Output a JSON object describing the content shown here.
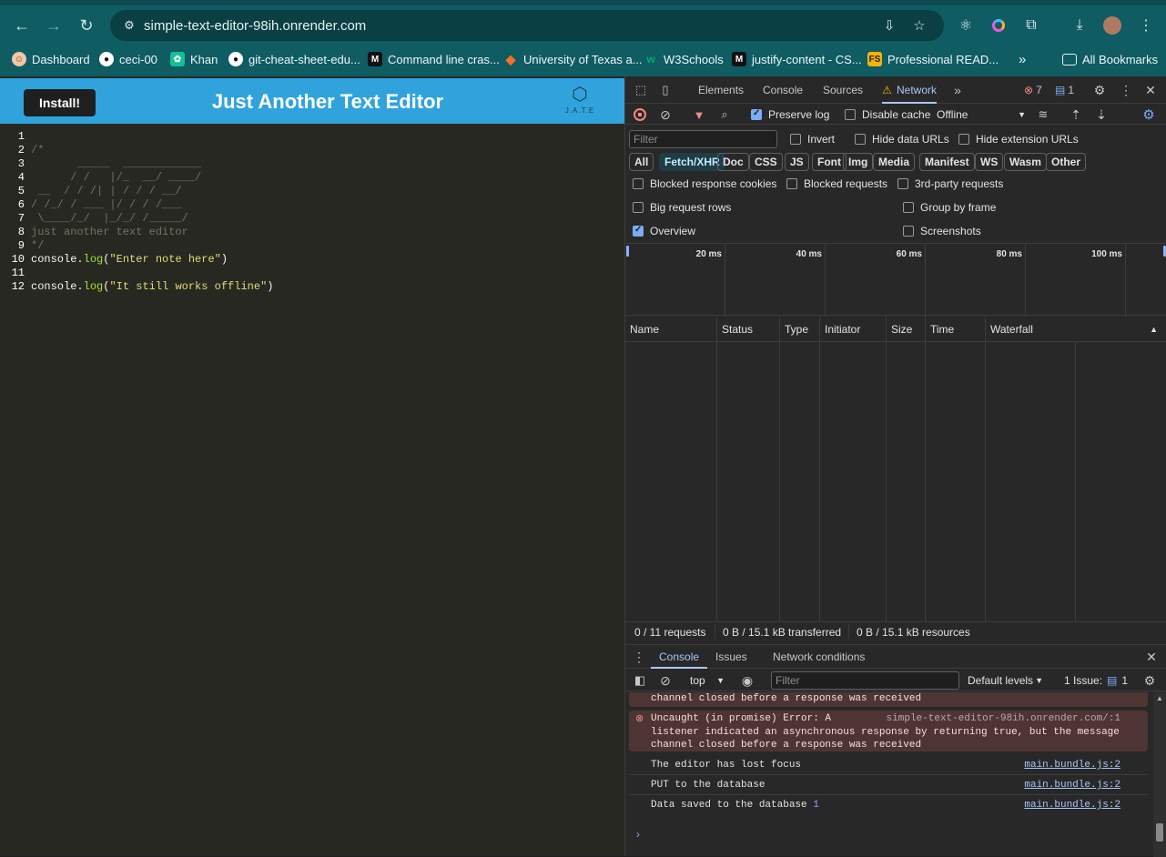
{
  "browser": {
    "url": "simple-text-editor-98ih.onrender.com",
    "bookmarks": [
      {
        "label": "Dashboard",
        "icon": "dashboard-favicon"
      },
      {
        "label": "ceci-00",
        "icon": "github-icon"
      },
      {
        "label": "Khan",
        "icon": "khan-icon"
      },
      {
        "label": "git-cheat-sheet-edu...",
        "icon": "github-icon"
      },
      {
        "label": "Command line cras...",
        "icon": "m-icon"
      },
      {
        "label": "University of Texas a...",
        "icon": "gitlab-icon"
      },
      {
        "label": "W3Schools",
        "icon": "w3schools-icon"
      },
      {
        "label": "justify-content - CS...",
        "icon": "m-icon"
      },
      {
        "label": "Professional READ...",
        "icon": "fs-icon"
      }
    ],
    "all_bookmarks": "All Bookmarks"
  },
  "app": {
    "install_label": "Install!",
    "title": "Just Another Text Editor",
    "logo_text": "J.A.T.E",
    "lines": [
      {
        "n": "1",
        "text": ""
      },
      {
        "n": "2",
        "text": "/*"
      },
      {
        "n": "3",
        "text": "       _____  ____________"
      },
      {
        "n": "4",
        "text": "      / /   |/_  __/ ____/"
      },
      {
        "n": "5",
        "text": " __  / / /| | / / / __/"
      },
      {
        "n": "6",
        "text": "/ /_/ / ___ |/ / / /___"
      },
      {
        "n": "7",
        "text": " \\____/_/  |_/_/ /_____/"
      },
      {
        "n": "8",
        "text": "just another text editor"
      },
      {
        "n": "9",
        "text": "*/"
      },
      {
        "n": "10",
        "obj": "console",
        "fn": "log",
        "str": "\"Enter note here\""
      },
      {
        "n": "11",
        "text": ""
      },
      {
        "n": "12",
        "obj": "console",
        "fn": "log",
        "str": "\"It still works offline\""
      }
    ]
  },
  "devtools": {
    "tabs": [
      "Elements",
      "Console",
      "Sources",
      "Network"
    ],
    "active_tab": "Network",
    "error_count": "7",
    "message_count": "1",
    "preserve_log": "Preserve log",
    "disable_cache": "Disable cache",
    "throttle": "Offline",
    "filter_placeholder": "Filter",
    "invert": "Invert",
    "hide_data_urls": "Hide data URLs",
    "hide_ext_urls": "Hide extension URLs",
    "type_filters": [
      "All",
      "Fetch/XHR",
      "Doc",
      "CSS",
      "JS",
      "Font",
      "Img",
      "Media",
      "Manifest",
      "WS",
      "Wasm",
      "Other"
    ],
    "active_filter": "Fetch/XHR",
    "blocked_cookies": "Blocked response cookies",
    "blocked_requests": "Blocked requests",
    "third_party": "3rd-party requests",
    "big_rows": "Big request rows",
    "group_by_frame": "Group by frame",
    "overview": "Overview",
    "screenshots": "Screenshots",
    "timeline_ticks": [
      "20 ms",
      "40 ms",
      "60 ms",
      "80 ms",
      "100 ms"
    ],
    "columns": [
      "Name",
      "Status",
      "Type",
      "Initiator",
      "Size",
      "Time",
      "Waterfall"
    ],
    "status": {
      "requests": "0 / 11 requests",
      "transferred": "0 B / 15.1 kB transferred",
      "resources": "0 B / 15.1 kB resources"
    },
    "drawer_tabs": [
      "Console",
      "Issues",
      "Network conditions"
    ],
    "context": "top",
    "console_filter": "Filter",
    "levels": "Default levels",
    "issues": "1 Issue:",
    "issues_count": "1",
    "messages": {
      "err_partial": "channel closed before a response was received",
      "err_head": "Uncaught (in promise) Error: A",
      "err_src": "simple-text-editor-98ih.onrender.com/:1",
      "err_l2": "listener indicated an asynchronous response by returning true, but the message",
      "err_l3": "channel closed before a response was received",
      "logs": [
        {
          "text": "The editor has lost focus",
          "src": "main.bundle.js:2",
          "num": ""
        },
        {
          "text": "PUT to the database",
          "src": "main.bundle.js:2",
          "num": ""
        },
        {
          "text": "Data saved to the database",
          "src": "main.bundle.js:2",
          "num": "1"
        }
      ]
    }
  }
}
